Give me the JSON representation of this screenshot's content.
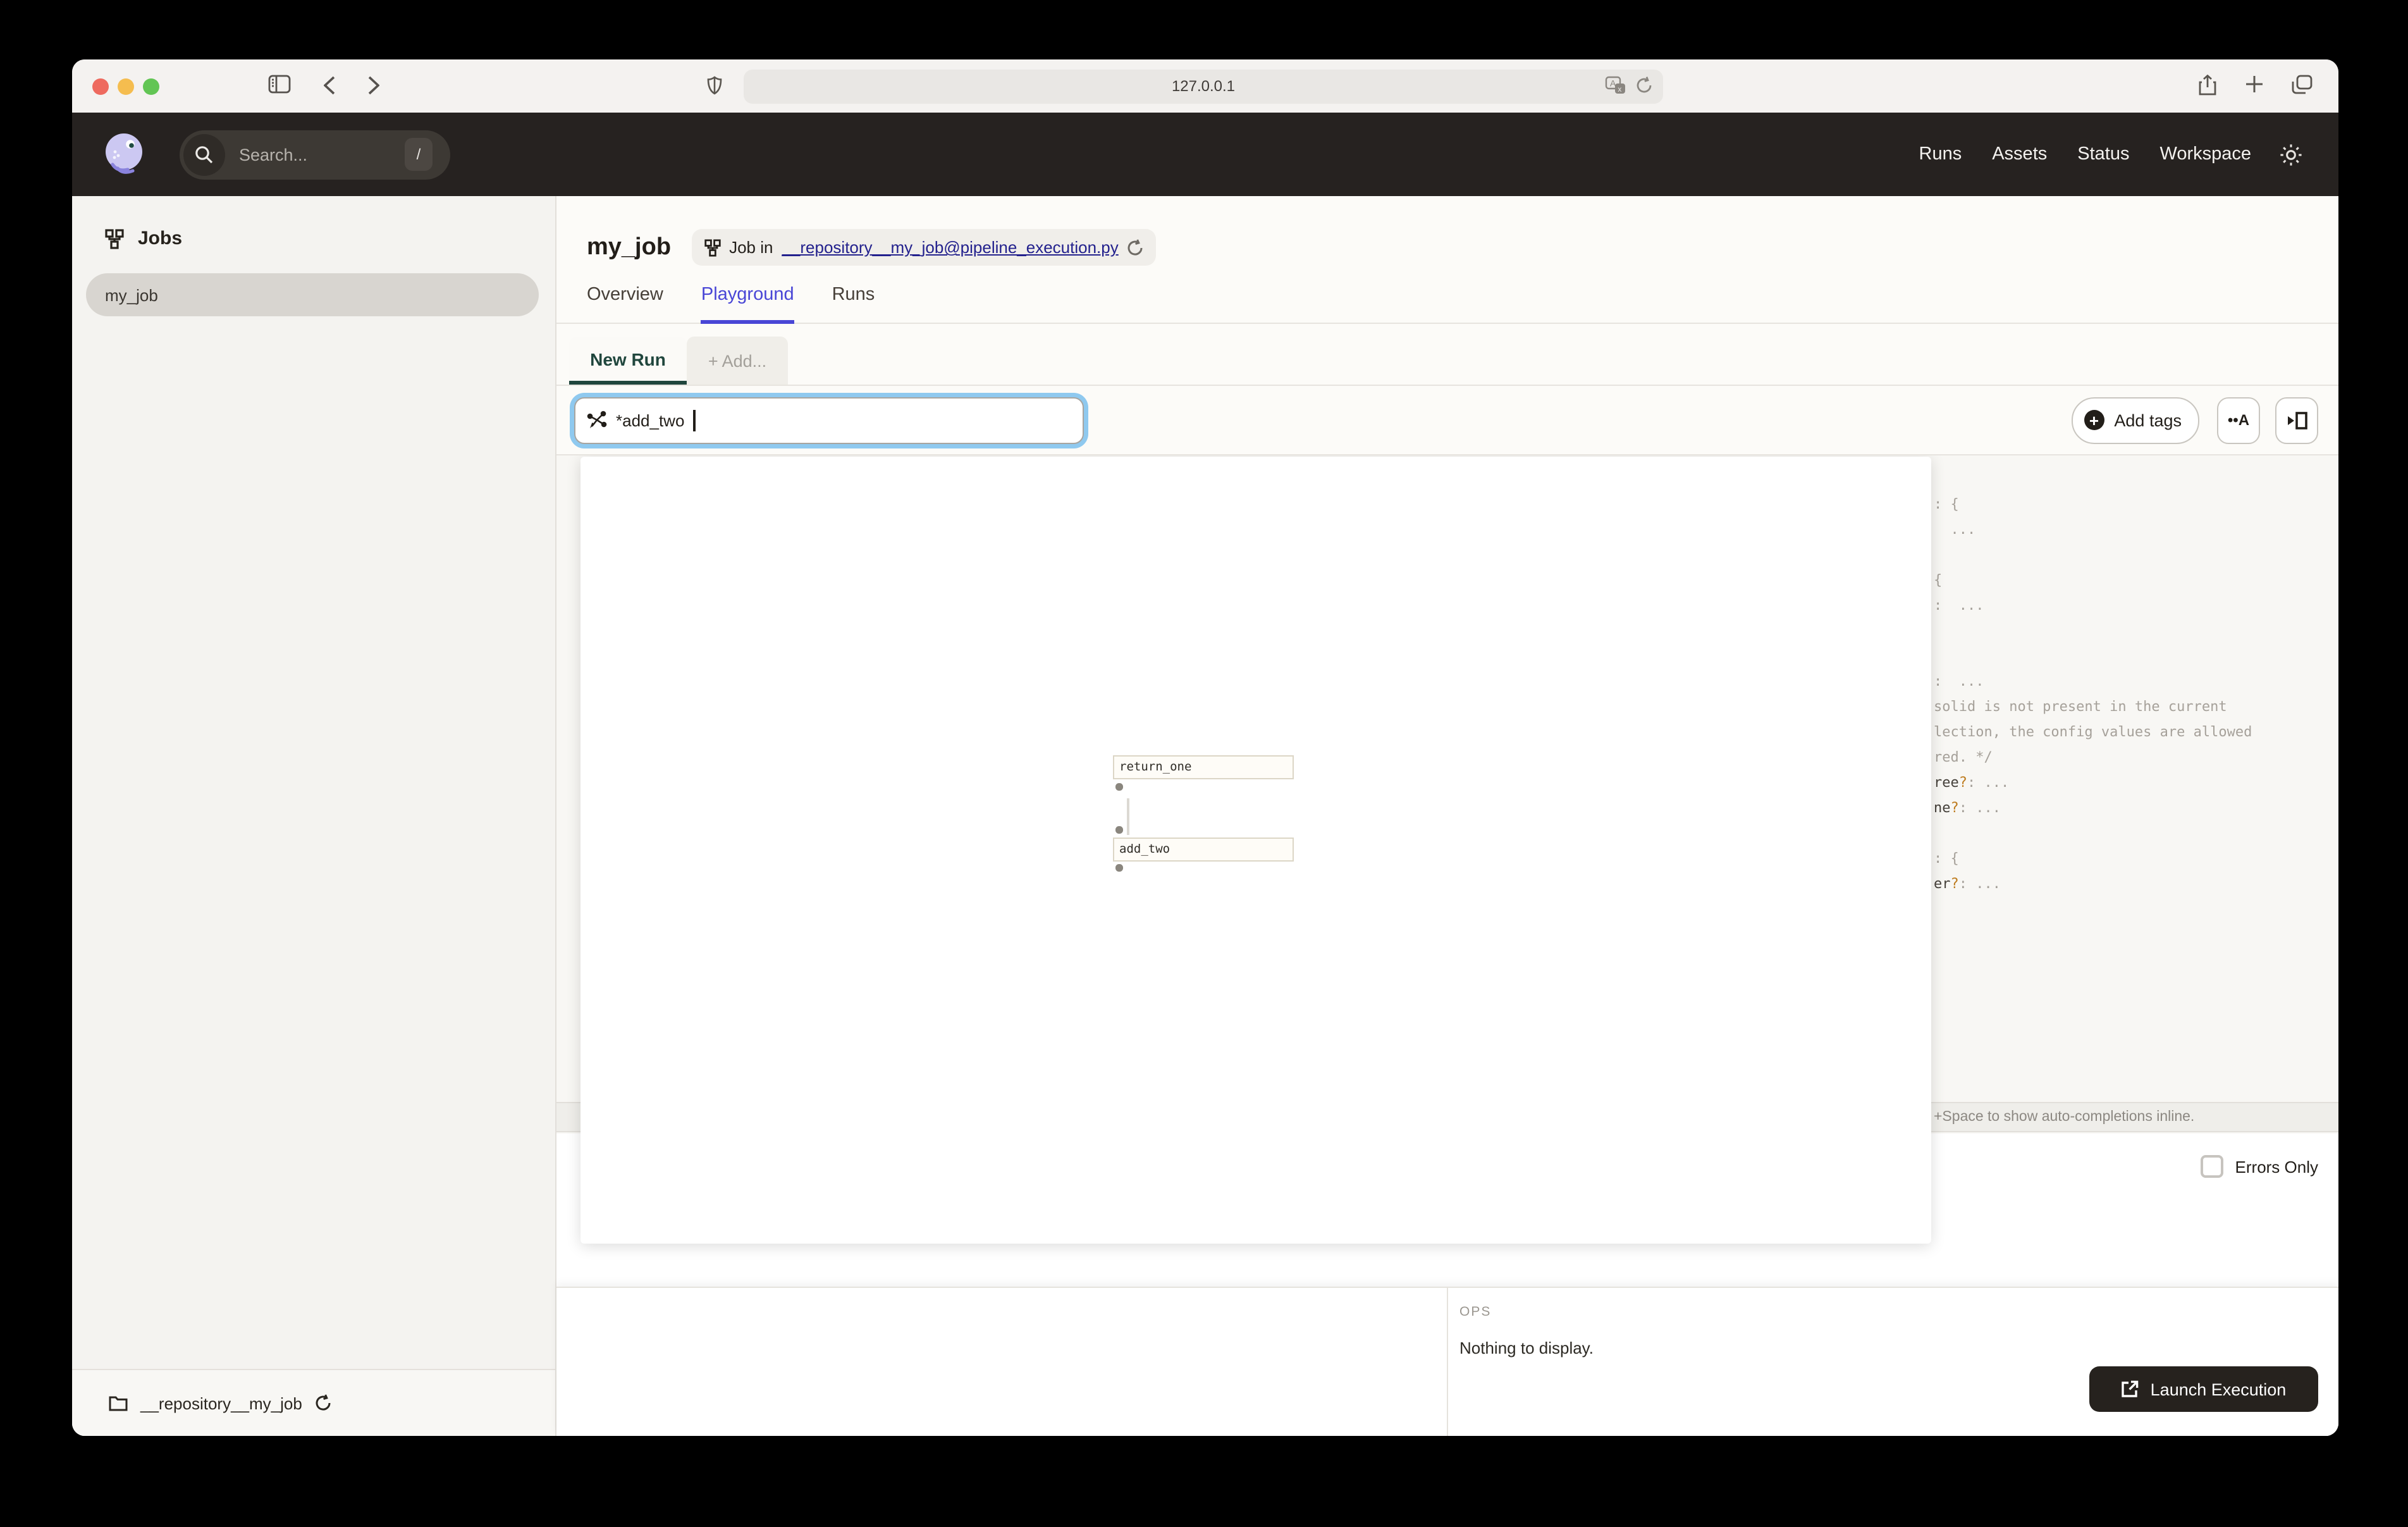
{
  "browser": {
    "url": "127.0.0.1"
  },
  "app_header": {
    "search_placeholder": "Search...",
    "search_shortcut": "/",
    "nav": [
      {
        "label": "Runs"
      },
      {
        "label": "Assets"
      },
      {
        "label": "Status"
      },
      {
        "label": "Workspace"
      }
    ]
  },
  "sidebar": {
    "title": "Jobs",
    "items": [
      {
        "label": "my_job",
        "selected": true
      }
    ],
    "footer": {
      "repository": "__repository__my_job"
    }
  },
  "page": {
    "title": "my_job",
    "badge": {
      "prefix": "Job in",
      "link": "__repository__my_job@pipeline_execution.py"
    },
    "tabs": [
      {
        "label": "Overview",
        "active": false
      },
      {
        "label": "Playground",
        "active": true
      },
      {
        "label": "Runs",
        "active": false
      }
    ]
  },
  "playground": {
    "run_tabs": {
      "new_run": "New Run",
      "add": "+ Add..."
    },
    "op_selector": {
      "value": "*add_two"
    },
    "toolbar": {
      "add_tags": "Add tags",
      "autocomplete_icon": "••A",
      "panel_icon": "play-panel"
    },
    "graph": {
      "nodes": [
        {
          "label": "return_one"
        },
        {
          "label": "add_two"
        }
      ]
    },
    "config_editor": {
      "lines": [
        [
          {
            "t": ": {",
            "c": "p"
          }
        ],
        [
          {
            "t": "  ...",
            "c": "p"
          }
        ],
        [],
        [
          {
            "t": "{",
            "c": "p"
          }
        ],
        [
          {
            "t": ":  ...",
            "c": "p"
          }
        ],
        [],
        [],
        [
          {
            "t": ":  ...",
            "c": "p"
          }
        ],
        [
          {
            "t": "solid is not present in the current",
            "c": "c"
          }
        ],
        [
          {
            "t": "lection, the config values are allowed",
            "c": "c"
          }
        ],
        [
          {
            "t": "red. */",
            "c": "c"
          }
        ],
        [
          {
            "t": "ree",
            "c": "k"
          },
          {
            "t": "?",
            "c": "q"
          },
          {
            "t": ": ...",
            "c": "p"
          }
        ],
        [
          {
            "t": "ne",
            "c": "k"
          },
          {
            "t": "?",
            "c": "q"
          },
          {
            "t": ": ...",
            "c": "p"
          }
        ],
        [],
        [
          {
            "t": ": {",
            "c": "p"
          }
        ],
        [
          {
            "t": "er",
            "c": "k"
          },
          {
            "t": "?",
            "c": "q"
          },
          {
            "t": ": ...",
            "c": "p"
          }
        ]
      ],
      "help_bar": "+Space to show auto-completions inline."
    },
    "preview": {
      "errors_only_label": "Errors Only"
    },
    "bottom_panel": {
      "ops_header": "OPS",
      "empty_message": "Nothing to display.",
      "launch_button": "Launch Execution"
    }
  },
  "colors": {
    "accent_blue": "#4946D6",
    "accent_green": "#20463D",
    "focus_ring": "#8FC9EF",
    "link_navy": "#23218D",
    "question_orange": "#BE7C1F",
    "header_dark": "#262220"
  }
}
